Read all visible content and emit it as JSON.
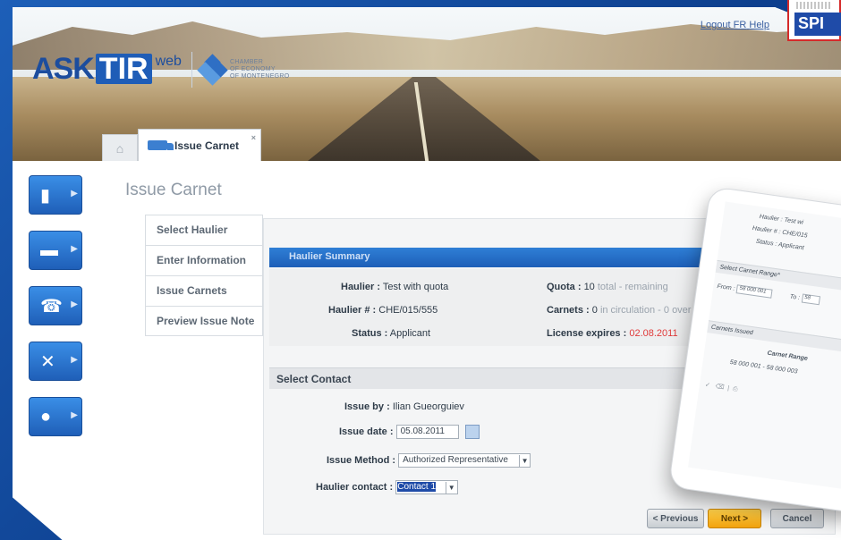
{
  "header": {
    "logout": "Logout",
    "lang": "FR",
    "link2": "Help",
    "brand_ask": "ASK",
    "brand_tir": "TIR",
    "brand_web": "web",
    "chamber_line1": "CHAMBER",
    "chamber_line2": "OF ECONOMY",
    "chamber_line3": "OF MONTENEGRO"
  },
  "corner_badge": "SPI",
  "tabs": {
    "home_icon": "home-icon",
    "active_label": "Issue Carnet",
    "close": "×"
  },
  "page_title": "Issue Carnet",
  "steps": [
    "Select Haulier",
    "Enter Information",
    "Issue Carnets",
    "Preview Issue Note"
  ],
  "summary": {
    "title": "Haulier Summary",
    "haulier_label": "Haulier :",
    "haulier_value": "Test with quota",
    "haulier_no_label": "Haulier # :",
    "haulier_no_value": "CHE/015/555",
    "status_label": "Status :",
    "status_value": "Applicant",
    "quota_label": "Quota :",
    "quota_value": "10",
    "quota_total": "total",
    "quota_sep": "-",
    "quota_remaining": "remaining",
    "carnets_label": "Carnets :",
    "carnets_value": "0",
    "in_circulation": "in circulation",
    "carnets_sep": "-",
    "overdue_value": "0",
    "overdue": "over",
    "license_label": "License expires :",
    "license_value": "02.08.2011"
  },
  "contact": {
    "title": "Select Contact",
    "issue_by_label": "Issue by :",
    "issue_by_value": "Ilian Gueorguiev",
    "issue_date_label": "Issue date :",
    "issue_date_value": "05.08.2011",
    "method_label": "Issue Method :",
    "method_value": "Authorized Representative",
    "haulier_contact_label": "Haulier contact :",
    "haulier_contact_value": "Contact 1"
  },
  "buttons": {
    "previous": "< Previous",
    "next": "Next >",
    "cancel": "Cancel"
  },
  "phone": {
    "haulier": "Haulier : Test wi",
    "haulier_no": "Haulier # : CHE/015",
    "status": "Status : Applicant",
    "range_title": "Select Carnet Range*",
    "from_label": "From :",
    "from_value": "58 000 001",
    "to_label": "To :",
    "to_value": "58",
    "issued_title": "Carnets Issued",
    "range_col": "Carnet Range",
    "range_row": "58 000 001 - 58 000 003"
  }
}
